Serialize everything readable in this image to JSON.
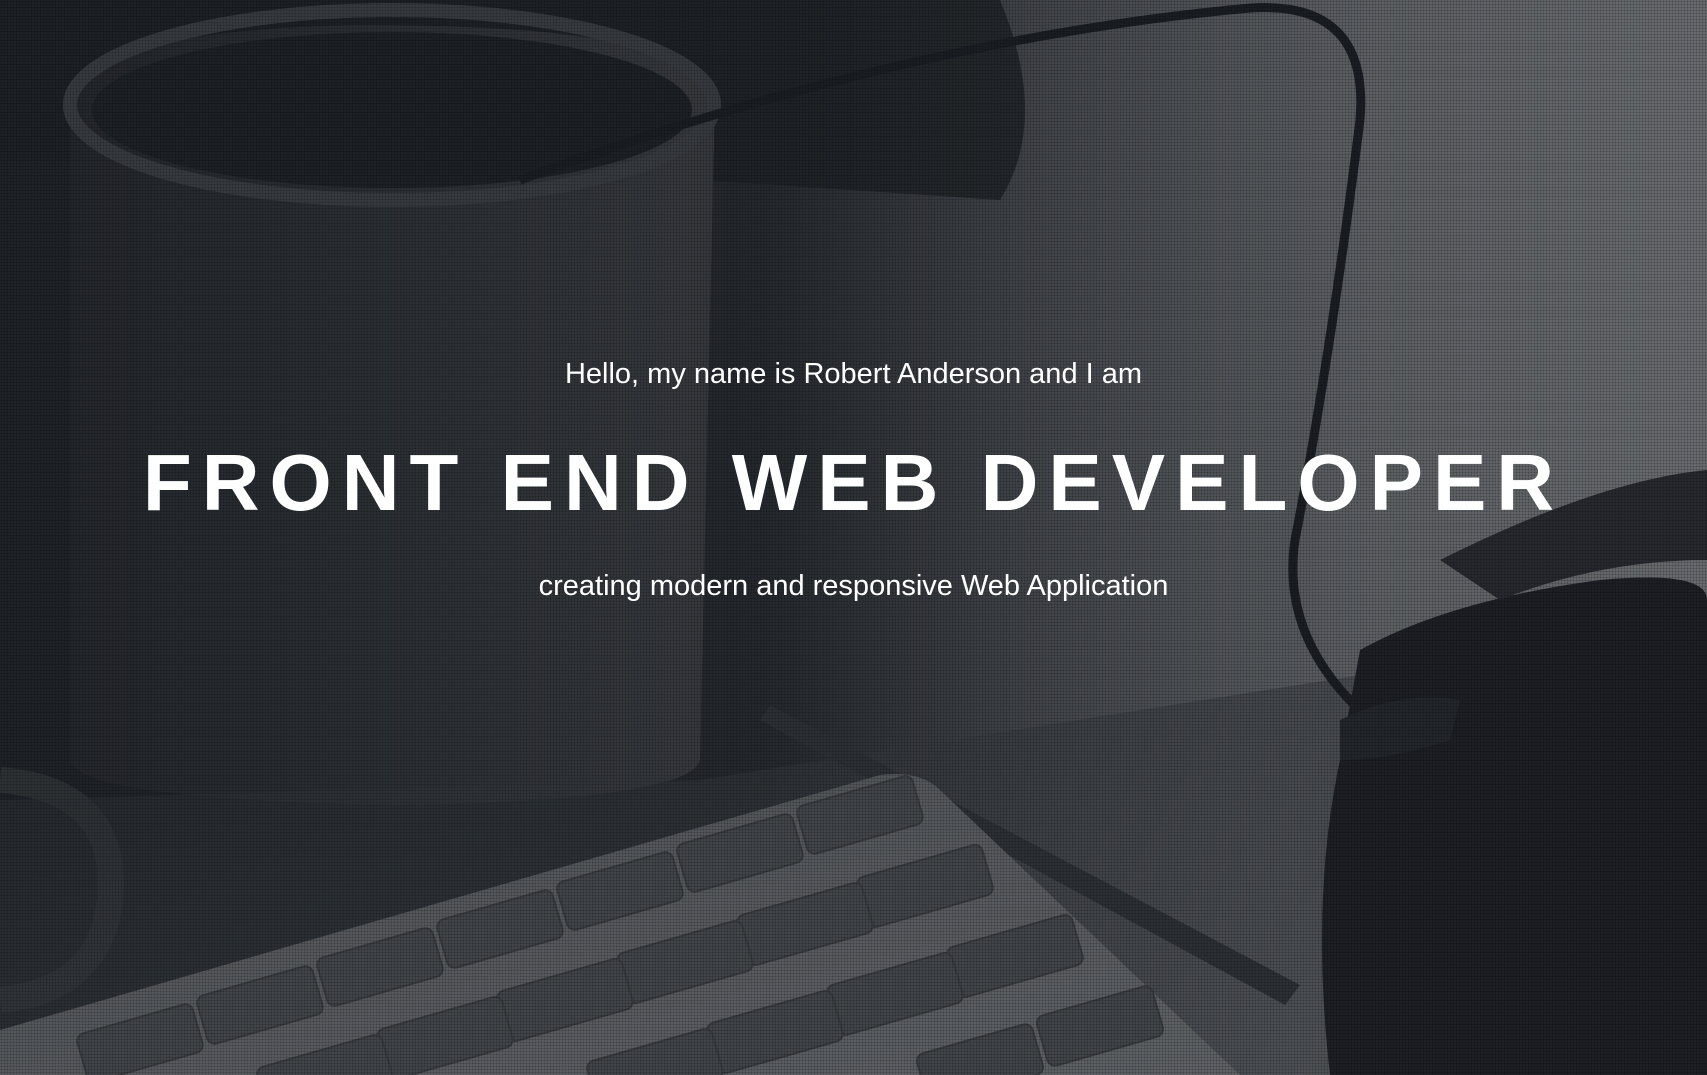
{
  "hero": {
    "intro": "Hello, my name is Robert Anderson and I am",
    "headline": "FRONT END WEB DEVELOPER",
    "tagline": "creating modern and responsive Web Application"
  },
  "colors": {
    "text": "#ffffff",
    "overlay": "#1c2024"
  }
}
